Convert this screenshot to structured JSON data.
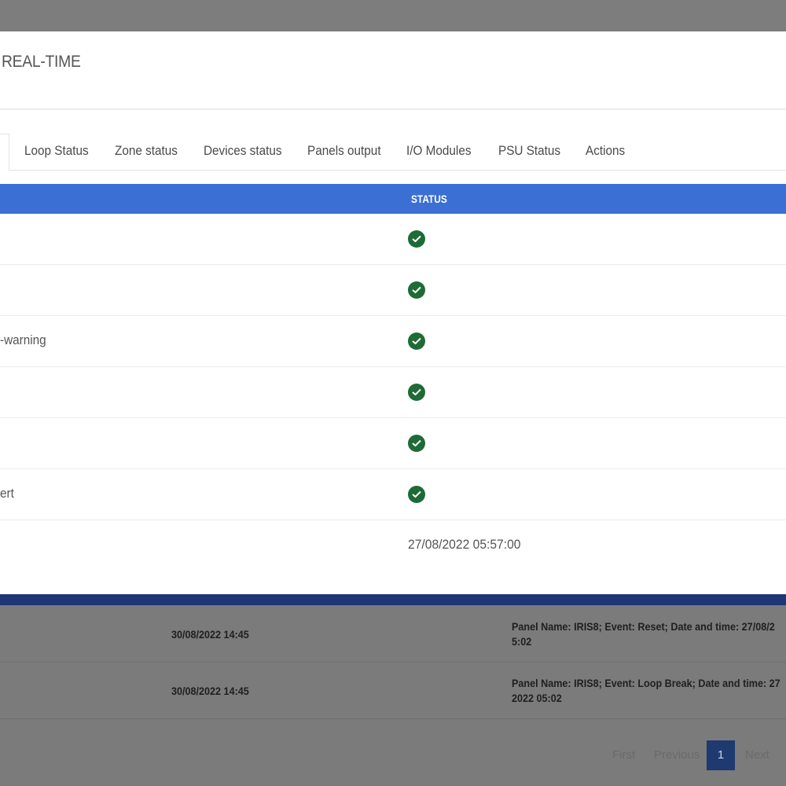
{
  "modal": {
    "title": "REAL-TIME",
    "tabs": [
      "Loop Status",
      "Zone status",
      "Devices status",
      "Panels output",
      "I/O Modules",
      "PSU Status",
      "Actions"
    ],
    "table": {
      "status_header": "STATUS",
      "rows": [
        {
          "label": "",
          "status": "ok"
        },
        {
          "label": "",
          "status": "ok"
        },
        {
          "label": "-warning",
          "status": "ok"
        },
        {
          "label": "",
          "status": "ok"
        },
        {
          "label": "",
          "status": "ok"
        },
        {
          "label": "ert",
          "status": "ok"
        },
        {
          "label": "",
          "value": "27/08/2022 05:57:00"
        }
      ]
    }
  },
  "background": {
    "events": [
      {
        "date": "30/08/2022 14:45",
        "description": "Panel Name: IRIS8; Event: Reset; Date and time: 27/08/2\n5:02"
      },
      {
        "date": "30/08/2022 14:45",
        "description": "Panel Name: IRIS8; Event: Loop Break; Date and time: 27\n2022 05:02"
      }
    ],
    "pagination": {
      "first": "First",
      "previous": "Previous",
      "current": "1",
      "next": "Next"
    }
  },
  "colors": {
    "header_blue": "#3b6fd4",
    "status_ok": "#1e6b35",
    "footer_bar": "#1f3676"
  },
  "icons": {
    "status_ok": "check-circle-icon"
  }
}
